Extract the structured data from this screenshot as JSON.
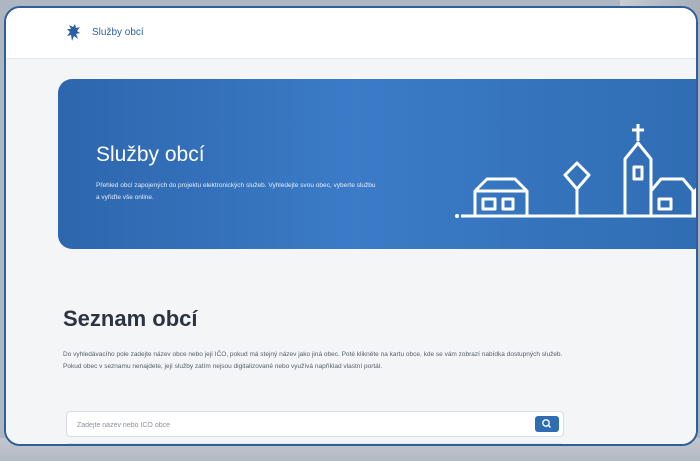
{
  "header": {
    "title": "Služby obcí",
    "logo_icon": "coat-of-arms-icon"
  },
  "hero": {
    "title": "Služby obcí",
    "description": "Přehled obcí zapojených do projektu elektronických služeb. Vyhledejte svou obec, vyberte službu a vyřiďte vše online."
  },
  "list_section": {
    "title": "Seznam obcí",
    "description": "Do vyhledávacího pole zadejte název obce nebo její IČO, pokud má stejný název jako jiná obec. Poté klikněte na kartu obce, kde se vám zobrazí nabídka dostupných služeb. Pokud obec v seznamu nenajdete, její služby zatím nejsou digitalizované nebo využívá například vlastní portál."
  },
  "search": {
    "placeholder": "Zadejte název nebo IČO obce",
    "value": "",
    "button_icon": "search-icon"
  },
  "colors": {
    "brand": "#2f6cb2",
    "frame": "#2f5e9a",
    "background": "#f4f5f7"
  }
}
